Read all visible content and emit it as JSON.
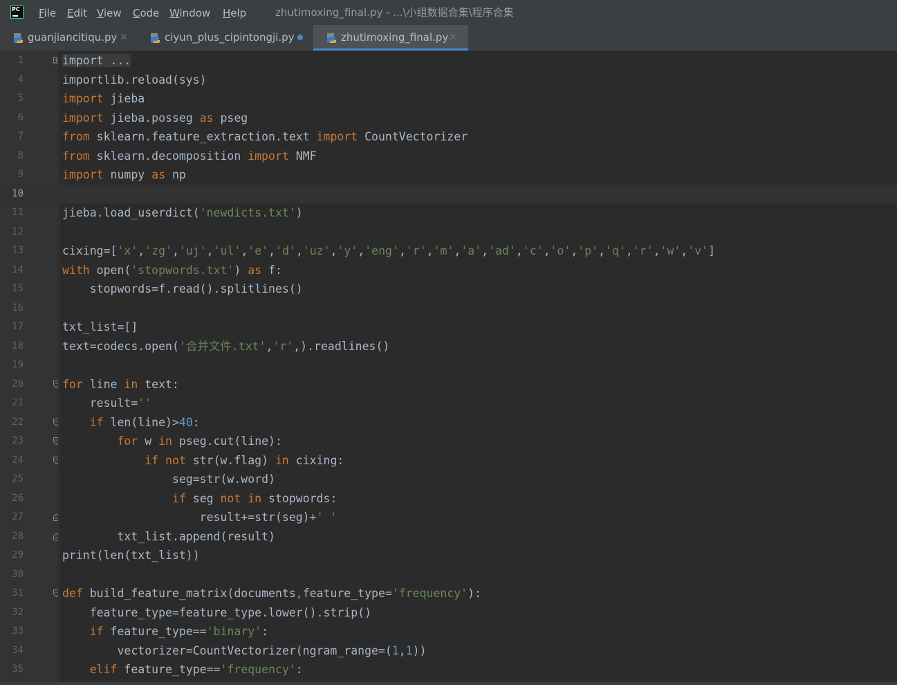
{
  "app": {
    "icon_text": "PC"
  },
  "menu": [
    {
      "id": "file",
      "label": "File"
    },
    {
      "id": "edit",
      "label": "Edit"
    },
    {
      "id": "view",
      "label": "View"
    },
    {
      "id": "code",
      "label": "Code"
    },
    {
      "id": "window",
      "label": "Window"
    },
    {
      "id": "help",
      "label": "Help"
    }
  ],
  "window_title": "zhutimoxing_final.py - ...\\小组数据合集\\程序合集",
  "tabs": [
    {
      "label": "guanjiancitiqu.py",
      "modified": false,
      "active": false
    },
    {
      "label": "ciyun_plus_cipintongji.py",
      "modified": true,
      "active": false
    },
    {
      "label": "zhutimoxing_final.py",
      "modified": false,
      "active": true
    }
  ],
  "colors": {
    "keyword": "#cc7832",
    "string": "#6a8759",
    "number": "#6897bb",
    "text": "#a9b7c6",
    "accent": "#4a88c7"
  },
  "editor": {
    "current_line": 10,
    "lines": [
      {
        "n": "1",
        "fold": "plus",
        "tokens": [
          {
            "t": "import ...",
            "c": "fold"
          }
        ]
      },
      {
        "n": "4",
        "tokens": [
          {
            "t": "importlib.reload(sys)"
          }
        ]
      },
      {
        "n": "5",
        "tokens": [
          {
            "t": "import",
            "c": "kw"
          },
          {
            "t": " jieba"
          }
        ]
      },
      {
        "n": "6",
        "tokens": [
          {
            "t": "import",
            "c": "kw"
          },
          {
            "t": " jieba.posseg "
          },
          {
            "t": "as",
            "c": "kw"
          },
          {
            "t": " pseg"
          }
        ]
      },
      {
        "n": "7",
        "tokens": [
          {
            "t": "from",
            "c": "kw"
          },
          {
            "t": " sklearn.feature_extraction.text "
          },
          {
            "t": "import",
            "c": "kw"
          },
          {
            "t": " CountVectorizer"
          }
        ]
      },
      {
        "n": "8",
        "tokens": [
          {
            "t": "from",
            "c": "kw"
          },
          {
            "t": " sklearn.decomposition "
          },
          {
            "t": "import",
            "c": "kw"
          },
          {
            "t": " NMF"
          }
        ]
      },
      {
        "n": "9",
        "tokens": [
          {
            "t": "import",
            "c": "kw"
          },
          {
            "t": " numpy "
          },
          {
            "t": "as",
            "c": "kw"
          },
          {
            "t": " np"
          }
        ]
      },
      {
        "n": "10",
        "tokens": []
      },
      {
        "n": "11",
        "tokens": [
          {
            "t": "jieba.load_userdict("
          },
          {
            "t": "'newdicts.txt'",
            "c": "str"
          },
          {
            "t": ")"
          }
        ]
      },
      {
        "n": "12",
        "tokens": []
      },
      {
        "n": "13",
        "tokens": [
          {
            "t": "cixing=["
          },
          {
            "t": "'x'",
            "c": "str"
          },
          {
            "t": ","
          },
          {
            "t": "'zg'",
            "c": "str"
          },
          {
            "t": ","
          },
          {
            "t": "'uj'",
            "c": "str"
          },
          {
            "t": ","
          },
          {
            "t": "'ul'",
            "c": "str"
          },
          {
            "t": ","
          },
          {
            "t": "'e'",
            "c": "str"
          },
          {
            "t": ","
          },
          {
            "t": "'d'",
            "c": "str"
          },
          {
            "t": ","
          },
          {
            "t": "'uz'",
            "c": "str"
          },
          {
            "t": ","
          },
          {
            "t": "'y'",
            "c": "str"
          },
          {
            "t": ","
          },
          {
            "t": "'eng'",
            "c": "str"
          },
          {
            "t": ","
          },
          {
            "t": "'r'",
            "c": "str"
          },
          {
            "t": ","
          },
          {
            "t": "'m'",
            "c": "str"
          },
          {
            "t": ","
          },
          {
            "t": "'a'",
            "c": "str"
          },
          {
            "t": ","
          },
          {
            "t": "'ad'",
            "c": "str"
          },
          {
            "t": ","
          },
          {
            "t": "'c'",
            "c": "str"
          },
          {
            "t": ","
          },
          {
            "t": "'o'",
            "c": "str"
          },
          {
            "t": ","
          },
          {
            "t": "'p'",
            "c": "str"
          },
          {
            "t": ","
          },
          {
            "t": "'q'",
            "c": "str"
          },
          {
            "t": ","
          },
          {
            "t": "'r'",
            "c": "str"
          },
          {
            "t": ","
          },
          {
            "t": "'w'",
            "c": "str"
          },
          {
            "t": ","
          },
          {
            "t": "'v'",
            "c": "str"
          },
          {
            "t": "]"
          }
        ]
      },
      {
        "n": "14",
        "tokens": [
          {
            "t": "with",
            "c": "kw"
          },
          {
            "t": " open("
          },
          {
            "t": "'stopwords.txt'",
            "c": "str"
          },
          {
            "t": ") "
          },
          {
            "t": "as",
            "c": "kw"
          },
          {
            "t": " f:"
          }
        ]
      },
      {
        "n": "15",
        "tokens": [
          {
            "t": "    stopwords=f.read().splitlines()"
          }
        ]
      },
      {
        "n": "16",
        "tokens": []
      },
      {
        "n": "17",
        "tokens": [
          {
            "t": "txt_list=[]"
          }
        ]
      },
      {
        "n": "18",
        "tokens": [
          {
            "t": "text=codecs.open("
          },
          {
            "t": "'合并文件.txt'",
            "c": "str"
          },
          {
            "t": ","
          },
          {
            "t": "'r'",
            "c": "str"
          },
          {
            "t": ",).readlines()"
          }
        ]
      },
      {
        "n": "19",
        "tokens": []
      },
      {
        "n": "20",
        "fold": "open",
        "tokens": [
          {
            "t": "for",
            "c": "kw"
          },
          {
            "t": " line "
          },
          {
            "t": "in",
            "c": "kw"
          },
          {
            "t": " text:"
          }
        ]
      },
      {
        "n": "21",
        "tokens": [
          {
            "t": "    result="
          },
          {
            "t": "''",
            "c": "str"
          }
        ]
      },
      {
        "n": "22",
        "fold": "open",
        "tokens": [
          {
            "t": "    "
          },
          {
            "t": "if",
            "c": "kw"
          },
          {
            "t": " len(line)>"
          },
          {
            "t": "40",
            "c": "num"
          },
          {
            "t": ":"
          }
        ]
      },
      {
        "n": "23",
        "fold": "open",
        "tokens": [
          {
            "t": "        "
          },
          {
            "t": "for",
            "c": "kw"
          },
          {
            "t": " w "
          },
          {
            "t": "in",
            "c": "kw"
          },
          {
            "t": " pseg.cut(line):"
          }
        ]
      },
      {
        "n": "24",
        "fold": "open",
        "tokens": [
          {
            "t": "            "
          },
          {
            "t": "if not",
            "c": "kw"
          },
          {
            "t": " str(w.flag) "
          },
          {
            "t": "in",
            "c": "kw"
          },
          {
            "t": " cixing:"
          }
        ]
      },
      {
        "n": "25",
        "tokens": [
          {
            "t": "                seg=str(w.word)"
          }
        ]
      },
      {
        "n": "26",
        "tokens": [
          {
            "t": "                "
          },
          {
            "t": "if",
            "c": "kw"
          },
          {
            "t": " seg "
          },
          {
            "t": "not in",
            "c": "kw"
          },
          {
            "t": " stopwords:"
          }
        ]
      },
      {
        "n": "27",
        "fold": "close",
        "tokens": [
          {
            "t": "                    result+=str(seg)+"
          },
          {
            "t": "' '",
            "c": "str"
          }
        ]
      },
      {
        "n": "28",
        "fold": "close",
        "tokens": [
          {
            "t": "        txt_list.append(result)"
          }
        ]
      },
      {
        "n": "29",
        "tokens": [
          {
            "t": "print(len(txt_list))"
          }
        ]
      },
      {
        "n": "30",
        "tokens": []
      },
      {
        "n": "31",
        "fold": "open",
        "tokens": [
          {
            "t": "def",
            "c": "kw"
          },
          {
            "t": " build_feature_matrix(documents"
          },
          {
            "t": ",",
            "c": "kw"
          },
          {
            "t": "feature_type="
          },
          {
            "t": "'frequency'",
            "c": "str"
          },
          {
            "t": "):"
          }
        ]
      },
      {
        "n": "32",
        "tokens": [
          {
            "t": "    feature_type=feature_type.lower().strip()"
          }
        ]
      },
      {
        "n": "33",
        "tokens": [
          {
            "t": "    "
          },
          {
            "t": "if",
            "c": "kw"
          },
          {
            "t": " feature_type=="
          },
          {
            "t": "'binary'",
            "c": "str"
          },
          {
            "t": ":"
          }
        ]
      },
      {
        "n": "34",
        "tokens": [
          {
            "t": "        vectorizer=CountVectorizer(ngram_range=("
          },
          {
            "t": "1",
            "c": "num"
          },
          {
            "t": ","
          },
          {
            "t": "1",
            "c": "num"
          },
          {
            "t": "))"
          }
        ]
      },
      {
        "n": "35",
        "tokens": [
          {
            "t": "    "
          },
          {
            "t": "elif",
            "c": "kw"
          },
          {
            "t": " feature_type=="
          },
          {
            "t": "'frequency'",
            "c": "str"
          },
          {
            "t": ":"
          }
        ]
      }
    ]
  }
}
